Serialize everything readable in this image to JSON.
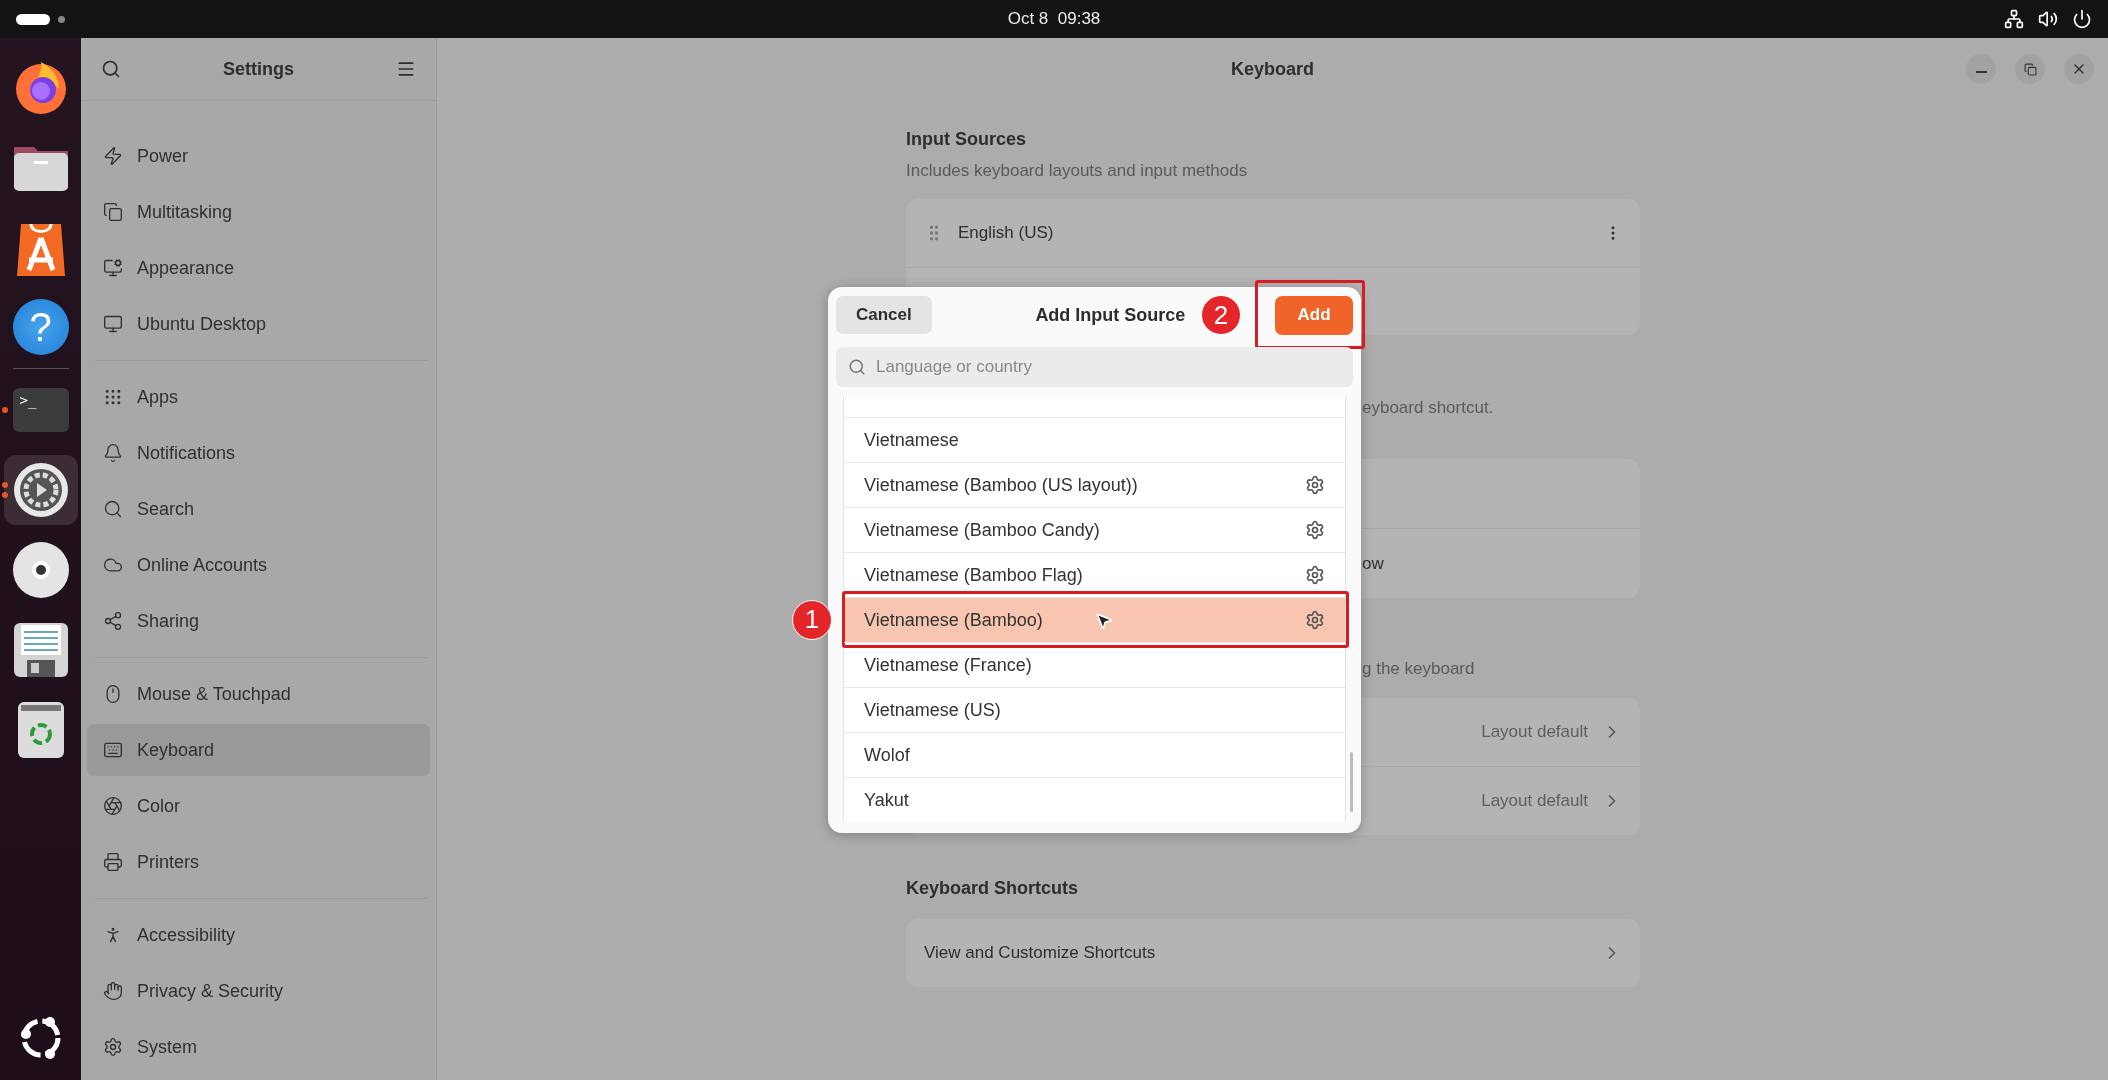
{
  "top_bar": {
    "clock": "Oct 8  09:38"
  },
  "dock": [
    {
      "kind": "browser",
      "running": false,
      "focused": false
    },
    {
      "kind": "files",
      "running": false,
      "focused": false
    },
    {
      "kind": "store",
      "running": false,
      "focused": false
    },
    {
      "kind": "help",
      "glyph": "?",
      "running": false,
      "focused": false
    },
    {
      "kind": "terminal",
      "glyph": ">_",
      "running": true,
      "focused": false
    },
    {
      "kind": "settings",
      "running": true,
      "focused": true
    },
    {
      "kind": "disc",
      "running": false,
      "focused": false
    },
    {
      "kind": "document",
      "running": false,
      "focused": false
    },
    {
      "kind": "trash",
      "running": false,
      "focused": false
    }
  ],
  "sidebar": {
    "title": "Settings",
    "groups": [
      {
        "items": [
          {
            "label": "Power",
            "selected": false
          },
          {
            "label": "Multitasking",
            "selected": false
          },
          {
            "label": "Appearance",
            "selected": false
          },
          {
            "label": "Ubuntu Desktop",
            "selected": false
          }
        ]
      },
      {
        "items": [
          {
            "label": "Apps",
            "selected": false
          },
          {
            "label": "Notifications",
            "selected": false
          },
          {
            "label": "Search",
            "selected": false
          },
          {
            "label": "Online Accounts",
            "selected": false
          },
          {
            "label": "Sharing",
            "selected": false
          }
        ]
      },
      {
        "items": [
          {
            "label": "Mouse & Touchpad",
            "selected": false
          },
          {
            "label": "Keyboard",
            "selected": true
          },
          {
            "label": "Color",
            "selected": false
          },
          {
            "label": "Printers",
            "selected": false
          }
        ]
      },
      {
        "items": [
          {
            "label": "Accessibility",
            "selected": false
          },
          {
            "label": "Privacy & Security",
            "selected": false
          },
          {
            "label": "System",
            "selected": false
          }
        ]
      }
    ]
  },
  "window": {
    "title": "Keyboard"
  },
  "input_sources": {
    "title": "Input Sources",
    "subtitle": "Includes keyboard layouts and input methods",
    "items": [
      {
        "label": "English (US)"
      }
    ]
  },
  "section_2": {
    "description": "eyboard shortcut.",
    "row_2": "ow"
  },
  "section_3": {
    "description": "g the keyboard",
    "rows": [
      {
        "value": "Layout default"
      },
      {
        "value": "Layout default"
      }
    ]
  },
  "shortcuts": {
    "title": "Keyboard Shortcuts",
    "rows": [
      {
        "label": "View and Customize Shortcuts"
      }
    ]
  },
  "dialog": {
    "title": "Add Input Source",
    "cancel": "Cancel",
    "add": "Add",
    "search": {
      "placeholder": "Language or country"
    },
    "items": [
      {
        "label": "Vietnamese",
        "has_settings": false,
        "selected": false
      },
      {
        "label": "Vietnamese (Bamboo (US layout))",
        "has_settings": true,
        "selected": false
      },
      {
        "label": "Vietnamese (Bamboo Candy)",
        "has_settings": true,
        "selected": false
      },
      {
        "label": "Vietnamese (Bamboo Flag)",
        "has_settings": true,
        "selected": false
      },
      {
        "label": "Vietnamese (Bamboo)",
        "has_settings": true,
        "selected": true
      },
      {
        "label": "Vietnamese (France)",
        "has_settings": false,
        "selected": false
      },
      {
        "label": "Vietnamese (US)",
        "has_settings": false,
        "selected": false
      },
      {
        "label": "Wolof",
        "has_settings": false,
        "selected": false
      },
      {
        "label": "Yakut",
        "has_settings": false,
        "selected": false
      }
    ]
  },
  "annotations": [
    {
      "number": "1",
      "kind": "row"
    },
    {
      "number": "2",
      "kind": "button"
    }
  ]
}
